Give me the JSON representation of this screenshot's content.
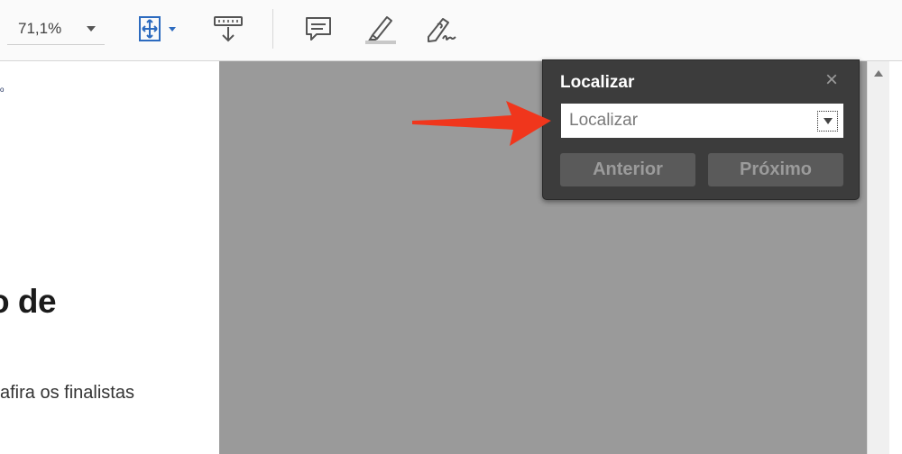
{
  "toolbar": {
    "zoom_value": "71,1%",
    "buttons": [
      {
        "name": "fit-page-icon",
        "has_dropdown": true
      },
      {
        "name": "scroll-mode-icon"
      },
      {
        "name": "comment-icon"
      },
      {
        "name": "highlight-icon"
      },
      {
        "name": "sign-icon"
      }
    ],
    "accent_color": "#2d6bbf"
  },
  "document": {
    "small_text": "o",
    "heading": "o de",
    "body": "afira os finalistas"
  },
  "find": {
    "title": "Localizar",
    "close_icon": "close-icon",
    "input_value": "",
    "input_placeholder": "Localizar",
    "previous_label": "Anterior",
    "next_label": "Próximo"
  },
  "annotation": {
    "arrow_color": "#f0361c"
  }
}
